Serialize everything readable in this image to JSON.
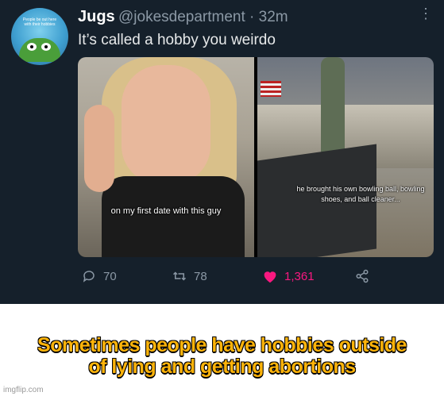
{
  "tweet": {
    "name": "Jugs",
    "handle": "@jokesdepartment · 32m",
    "text": "It’s called a hobby you weirdo",
    "avatar_text": "People be out here with their hobbies",
    "media": {
      "left_caption": "on my first date with this guy",
      "right_caption": "he brought his own bowling ball, bowling shoes, and ball cleaner..."
    },
    "actions": {
      "replies": "70",
      "retweets": "78",
      "likes": "1,361"
    },
    "colors": {
      "background": "#15202b",
      "like": "#f91880",
      "muted": "#8b98a5"
    }
  },
  "meme": {
    "caption_line1": "Sometimes people have hobbies outside",
    "caption_line2": "of lying and getting abortions",
    "watermark": "imgflip.com",
    "caption_color": "#ffb40a"
  }
}
